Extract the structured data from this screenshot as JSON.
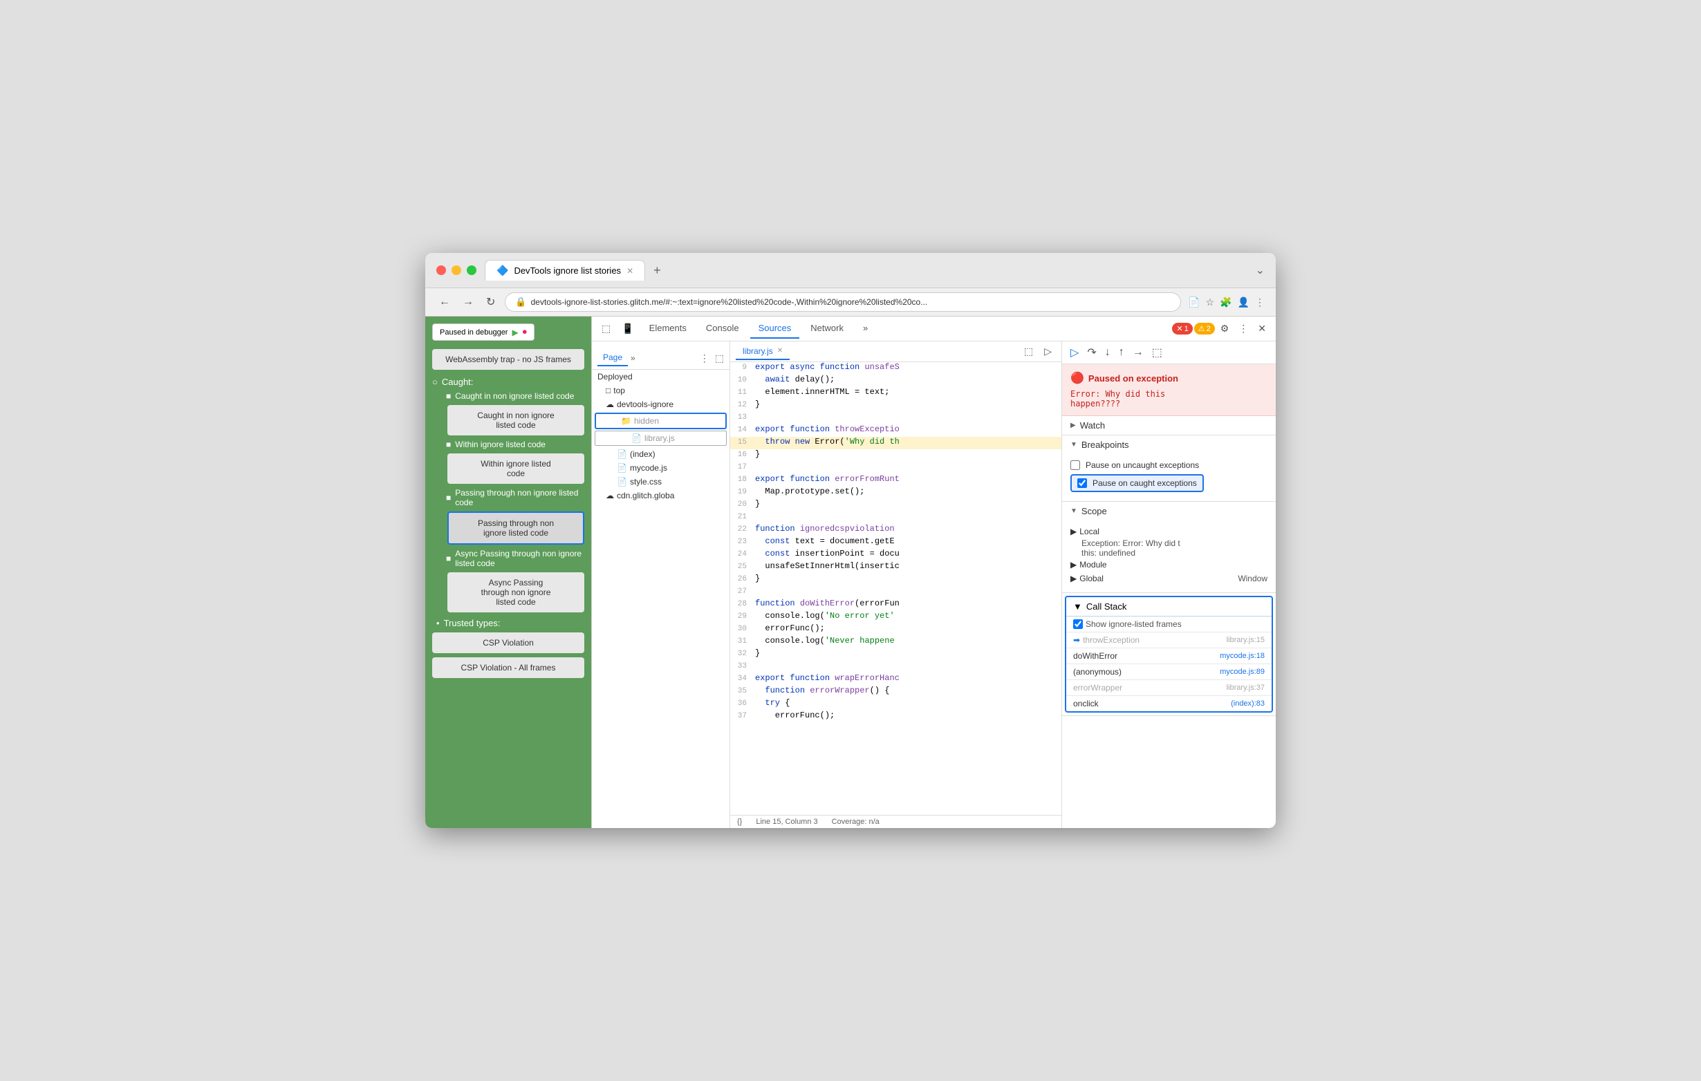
{
  "browser": {
    "tab_title": "DevTools ignore list stories",
    "tab_icon": "🔷",
    "url": "devtools-ignore-list-stories.glitch.me/#:~:text=ignore%20listed%20code-,Within%20ignore%20listed%20co...",
    "nav": {
      "back": "←",
      "forward": "→",
      "reload": "↻"
    }
  },
  "left_panel": {
    "paused_badge": "Paused in debugger",
    "webassembly_text": "WebAssembly trap - no JS frames",
    "caught_label": "Caught:",
    "items": [
      {
        "label": "Caught in non ignore listed code",
        "box_label": "Caught in non ignore listed code",
        "highlighted": false
      },
      {
        "label": "Within ignore listed code",
        "box_label": "Within ignore listed code",
        "highlighted": false
      },
      {
        "label": "Passing through non ignore listed code",
        "box_label": "Passing through non ignore listed code",
        "highlighted": true
      },
      {
        "label": "Async Passing through non ignore listed code",
        "box_label": "Async Passing through non ignore listed code",
        "highlighted": false
      }
    ],
    "trusted_label": "Trusted types:",
    "csp_items": [
      "CSP Violation",
      "CSP Violation - All frames"
    ]
  },
  "devtools": {
    "tabs": [
      "Elements",
      "Console",
      "Sources",
      "Network"
    ],
    "active_tab": "Sources",
    "error_count": "1",
    "warn_count": "2",
    "source_tabs": [
      "Page"
    ],
    "active_source_tab": "Page",
    "file_tree": {
      "items": [
        {
          "label": "Deployed",
          "type": "section",
          "indent": 0
        },
        {
          "label": "top",
          "type": "folder",
          "indent": 1
        },
        {
          "label": "devtools-ignore",
          "type": "cloud-folder",
          "indent": 1
        },
        {
          "label": "hidden",
          "type": "folder",
          "indent": 2,
          "highlighted": true
        },
        {
          "label": "library.js",
          "type": "file",
          "indent": 3,
          "highlighted": true
        },
        {
          "label": "(index)",
          "type": "file",
          "indent": 2
        },
        {
          "label": "mycode.js",
          "type": "file-orange",
          "indent": 2
        },
        {
          "label": "style.css",
          "type": "file-orange",
          "indent": 2
        },
        {
          "label": "cdn.glitch.globa",
          "type": "cloud-folder",
          "indent": 1
        }
      ]
    },
    "code_file": "library.js",
    "code_lines": [
      {
        "num": 9,
        "content": "export async function unsafeS",
        "highlight": false
      },
      {
        "num": 10,
        "content": "  await delay();",
        "highlight": false
      },
      {
        "num": 11,
        "content": "  element.innerHTML = text;",
        "highlight": false
      },
      {
        "num": 12,
        "content": "}",
        "highlight": false
      },
      {
        "num": 13,
        "content": "",
        "highlight": false
      },
      {
        "num": 14,
        "content": "export function throwExceptio",
        "highlight": false
      },
      {
        "num": 15,
        "content": "  throw new Error('Why did th",
        "highlight": true
      },
      {
        "num": 16,
        "content": "}",
        "highlight": false
      },
      {
        "num": 17,
        "content": "",
        "highlight": false
      },
      {
        "num": 18,
        "content": "export function errorFromRunt",
        "highlight": false
      },
      {
        "num": 19,
        "content": "  Map.prototype.set();",
        "highlight": false
      },
      {
        "num": 20,
        "content": "}",
        "highlight": false
      },
      {
        "num": 21,
        "content": "",
        "highlight": false
      },
      {
        "num": 22,
        "content": "function ignoredcspviolation",
        "highlight": false
      },
      {
        "num": 23,
        "content": "  const text = document.getE",
        "highlight": false
      },
      {
        "num": 24,
        "content": "  const insertionPoint = docu",
        "highlight": false
      },
      {
        "num": 25,
        "content": "  unsafeSetInnerHtml(insertic",
        "highlight": false
      },
      {
        "num": 26,
        "content": "}",
        "highlight": false
      },
      {
        "num": 27,
        "content": "",
        "highlight": false
      },
      {
        "num": 28,
        "content": "function doWithError(errorFun",
        "highlight": false
      },
      {
        "num": 29,
        "content": "  console.log('No error yet'",
        "highlight": false
      },
      {
        "num": 30,
        "content": "  errorFunc();",
        "highlight": false
      },
      {
        "num": 31,
        "content": "  console.log('Never happene",
        "highlight": false
      },
      {
        "num": 32,
        "content": "}",
        "highlight": false
      },
      {
        "num": 33,
        "content": "",
        "highlight": false
      },
      {
        "num": 34,
        "content": "export function wrapErrorHanc",
        "highlight": false
      },
      {
        "num": 35,
        "content": "  function errorWrapper() {",
        "highlight": false
      },
      {
        "num": 36,
        "content": "  try {",
        "highlight": false
      },
      {
        "num": 37,
        "content": "    errorFunc();",
        "highlight": false
      }
    ],
    "status_bar": {
      "line": "Line 15, Column 3",
      "coverage": "Coverage: n/a"
    }
  },
  "right_panel": {
    "exception": {
      "title": "Paused on exception",
      "message": "Error: Why did this\nhappen????"
    },
    "watch_label": "Watch",
    "breakpoints_label": "Breakpoints",
    "pause_uncaught_label": "Pause on uncaught exceptions",
    "pause_caught_label": "Pause on caught exceptions",
    "scope_label": "Scope",
    "local_label": "Local",
    "exception_local": "Exception: Error: Why did t",
    "this_val": "this:  undefined",
    "module_label": "Module",
    "global_label": "Global",
    "global_val": "Window",
    "call_stack_label": "Call Stack",
    "show_ignore_label": "Show ignore-listed frames",
    "call_stack": [
      {
        "fn": "throwException",
        "loc": "library.js:15",
        "muted": true,
        "arrow": true
      },
      {
        "fn": "doWithError",
        "loc": "mycode.js:18",
        "muted": false,
        "arrow": false
      },
      {
        "fn": "(anonymous)",
        "loc": "mycode.js:89",
        "muted": false,
        "arrow": false
      },
      {
        "fn": "errorWrapper",
        "loc": "library.js:37",
        "muted": true,
        "arrow": false
      },
      {
        "fn": "onclick",
        "loc": "(index):83",
        "muted": false,
        "arrow": false
      }
    ]
  }
}
